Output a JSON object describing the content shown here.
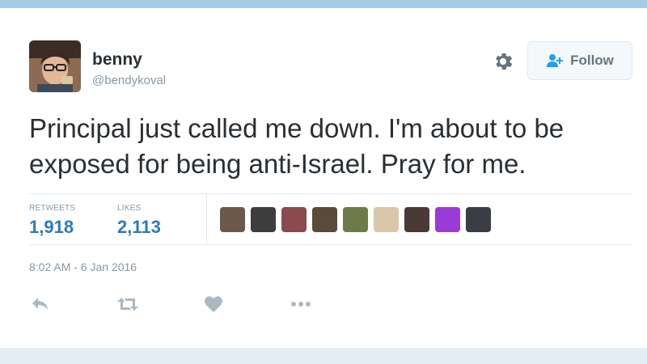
{
  "tweet": {
    "author": {
      "name": "benny",
      "handle": "@bendykoval"
    },
    "follow_label": "Follow",
    "text": "Principal just called me down. I'm about to be exposed for being anti-Israel. Pray for me.",
    "stats": {
      "retweets_label": "RETWEETS",
      "retweets_count": "1,918",
      "likes_label": "LIKES",
      "likes_count": "2,113"
    },
    "timestamp": "8:02 AM - 6 Jan 2016",
    "liker_avatars": [
      {
        "color": "#6b5a4a"
      },
      {
        "color": "#3d3d3d"
      },
      {
        "color": "#8a4a50"
      },
      {
        "color": "#5a4a3a"
      },
      {
        "color": "#6e7a4a"
      },
      {
        "color": "#d9c7a8"
      },
      {
        "color": "#4a3a35"
      },
      {
        "color": "#9a3bd8"
      },
      {
        "color": "#3a3d44"
      }
    ]
  },
  "actions": [
    {
      "name": "reply-icon"
    },
    {
      "name": "retweet-icon"
    },
    {
      "name": "like-icon"
    },
    {
      "name": "more-icon"
    }
  ],
  "colors": {
    "accent": "#2b7bb9",
    "muted": "#8899a6",
    "text": "#292f33",
    "action_icon": "#aab8c2"
  }
}
